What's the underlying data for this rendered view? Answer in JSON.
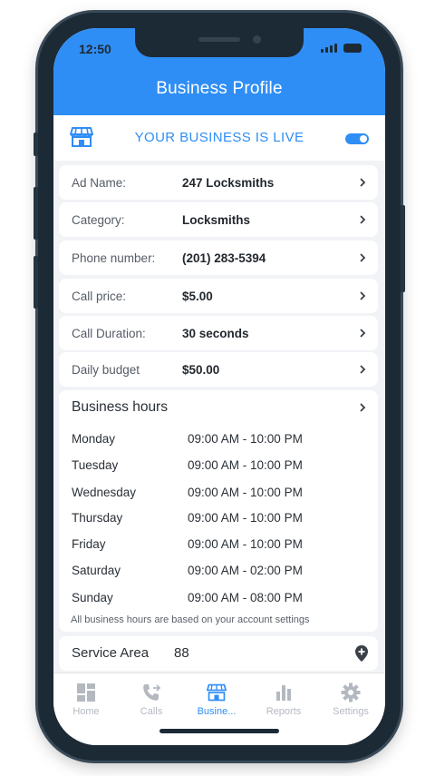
{
  "status_bar": {
    "time": "12:50"
  },
  "header": {
    "title": "Business Profile"
  },
  "live_banner": {
    "text": "YOUR BUSINESS IS LIVE",
    "enabled": true
  },
  "details": [
    {
      "label": "Ad Name:",
      "value": "247 Locksmiths"
    },
    {
      "label": "Category:",
      "value": "Locksmiths"
    },
    {
      "label": "Phone number:",
      "value": "(201) 283-5394"
    },
    {
      "label": "Call price:",
      "value": "$5.00"
    },
    {
      "label": "Call Duration:",
      "value": "30 seconds"
    },
    {
      "label": "Daily budget",
      "value": "$50.00"
    }
  ],
  "business_hours": {
    "title": "Business hours",
    "days": [
      {
        "day": "Monday",
        "hours": "09:00 AM - 10:00 PM"
      },
      {
        "day": "Tuesday",
        "hours": "09:00 AM - 10:00 PM"
      },
      {
        "day": "Wednesday",
        "hours": "09:00 AM - 10:00 PM"
      },
      {
        "day": "Thursday",
        "hours": "09:00 AM - 10:00 PM"
      },
      {
        "day": "Friday",
        "hours": "09:00 AM - 10:00 PM"
      },
      {
        "day": "Saturday",
        "hours": "09:00 AM - 02:00 PM"
      },
      {
        "day": "Sunday",
        "hours": "09:00 AM - 08:00 PM"
      }
    ],
    "note": "All business hours are based on your account settings"
  },
  "service_area": {
    "label": "Service Area",
    "count": "88"
  },
  "tabs": [
    {
      "label": "Home",
      "icon": "home-grid-icon",
      "active": false
    },
    {
      "label": "Calls",
      "icon": "phone-forward-icon",
      "active": false
    },
    {
      "label": "Busine...",
      "icon": "store-icon",
      "active": true
    },
    {
      "label": "Reports",
      "icon": "bar-chart-icon",
      "active": false
    },
    {
      "label": "Settings",
      "icon": "gear-icon",
      "active": false
    }
  ],
  "colors": {
    "primary": "#2f8ef5",
    "inactive_tab": "#b4b9c0",
    "background": "#f1f3f6"
  }
}
